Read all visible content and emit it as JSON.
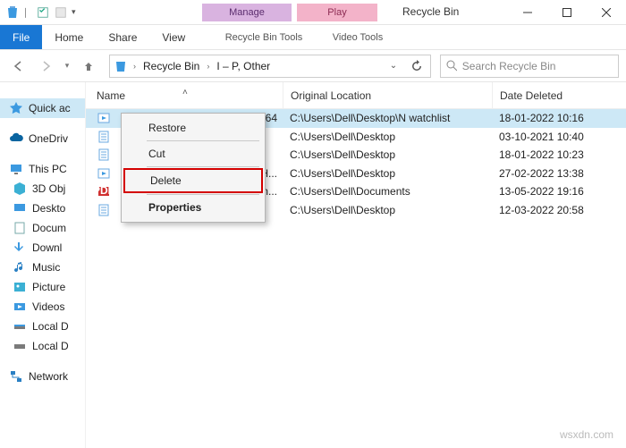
{
  "window": {
    "title": "Recycle Bin",
    "context_tabs": {
      "manage": "Manage",
      "play": "Play",
      "manage_tool": "Recycle Bin Tools",
      "play_tool": "Video Tools"
    }
  },
  "ribbon": {
    "file": "File",
    "home": "Home",
    "share": "Share",
    "view": "View"
  },
  "address": {
    "root": "Recycle Bin",
    "path": "I – P, Other"
  },
  "search": {
    "placeholder": "Search Recycle Bin"
  },
  "sidebar": {
    "quick": "Quick ac",
    "onedrive": "OneDriv",
    "thispc": "This PC",
    "items": [
      {
        "label": "3D Obj"
      },
      {
        "label": "Deskto"
      },
      {
        "label": "Docum"
      },
      {
        "label": "Downl"
      },
      {
        "label": "Music"
      },
      {
        "label": "Picture"
      },
      {
        "label": "Videos"
      },
      {
        "label": "Local D"
      },
      {
        "label": "Local D"
      }
    ],
    "network": "Network"
  },
  "columns": {
    "name": "Name",
    "orig": "Original Location",
    "date": "Date Deleted"
  },
  "rows": [
    {
      "name_tail": "264",
      "orig": "C:\\Users\\Dell\\Desktop\\N watchlist",
      "date": "18-01-2022 10:16",
      "icon": "video",
      "selected": true
    },
    {
      "name_tail": "",
      "orig": "C:\\Users\\Dell\\Desktop",
      "date": "03-10-2021 10:40",
      "icon": "doc"
    },
    {
      "name_tail": "",
      "orig": "C:\\Users\\Dell\\Desktop",
      "date": "18-01-2022 10:23",
      "icon": "doc"
    },
    {
      "name_tail": "l H...",
      "orig": "C:\\Users\\Dell\\Desktop",
      "date": "27-02-2022 13:38",
      "icon": "video"
    },
    {
      "name_tail": "rm...",
      "orig": "C:\\Users\\Dell\\Documents",
      "date": "13-05-2022 19:16",
      "icon": "pdf"
    },
    {
      "name_tail": "",
      "orig": "C:\\Users\\Dell\\Desktop",
      "date": "12-03-2022 20:58",
      "icon": "doc"
    }
  ],
  "context_menu": {
    "restore": "Restore",
    "cut": "Cut",
    "delete": "Delete",
    "properties": "Properties"
  },
  "watermark": "wsxdn.com"
}
